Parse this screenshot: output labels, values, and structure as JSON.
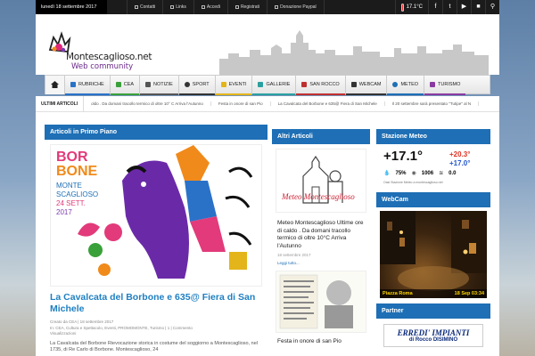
{
  "topbar": {
    "date": "lunedì 18 settembre 2017",
    "links": [
      "Contatti",
      "Links",
      "Accedi",
      "Registrati",
      "Donazione Paypal"
    ],
    "temperature": "17.1°C",
    "social": [
      "facebook-icon",
      "twitter-icon",
      "youtube-icon",
      "video-icon",
      "search-icon"
    ]
  },
  "header": {
    "logo_text": "Montescaglioso.net",
    "logo_sub": "Web community"
  },
  "nav": {
    "items": [
      {
        "label": "RUBRICHE",
        "color": "#2a72c8"
      },
      {
        "label": "CEA",
        "color": "#3aa03a"
      },
      {
        "label": "NOTIZIE",
        "color": "#555555"
      },
      {
        "label": "SPORT",
        "color": "#333333"
      },
      {
        "label": "EVENTI",
        "color": "#e3b51a"
      },
      {
        "label": "GALLERIE",
        "color": "#2aa0a0"
      },
      {
        "label": "SAN ROCCO",
        "color": "#c03030"
      },
      {
        "label": "WEBCAM",
        "color": "#333333"
      },
      {
        "label": "METEO",
        "color": "#1e6fb5"
      },
      {
        "label": "TURISMO",
        "color": "#8a3aa0"
      }
    ]
  },
  "ticker": {
    "label": "ULTIMI ARTICOLI",
    "items": [
      "oldo . Da domani tracollo termico di oltre 10° C Arriva l'Autunno",
      "Festa in onore di san Pio",
      "La Cavalcata del Borbone e 635@ Fiera di San Michele",
      "Il 20 settembre sarà presentato \"Tutipe\" al N"
    ]
  },
  "primo_piano": {
    "title": "Articoli in Primo Piano",
    "poster_lines": [
      "BOR",
      "BONE",
      "MONTE",
      "SCAGLIOSO",
      "24 SETT.",
      "2017"
    ],
    "headline": "La Cavalcata del Borbone e 635@ Fiera di San Michele",
    "meta1": "Creato da CEA  |  18 settembre 2017",
    "meta2": "In: CEA, Cultura e Spettacolo, Eventi, PROMOMONTE, Turismo  |  1  |  Commento",
    "meta3": "Visualizzazioni",
    "excerpt": "La Cavalcata del Borbone Rievocazione storica in costume del soggiorno a Montescaglioso, nel 1735, di Re Carlo di Borbone. Montescaglioso, 24"
  },
  "altri": {
    "title": "Altri Articoli",
    "thumb_label": "Meteo Montescaglioso",
    "article_title": "Meteo Montescaglioso Ultime ore di caldo . Da domani tracollo termico di oltre 10°C Arriva l'Autunno",
    "article_date": "18 settembre 2017",
    "read_more": "Leggi tutto...",
    "article2_title": "Festa in onore di san Pio"
  },
  "meteo": {
    "title": "Stazione Meteo",
    "temp": "+17.1°",
    "hi": "+20.3°",
    "lo": "+17.0°",
    "humidity": "75%",
    "pressure": "1006",
    "wind": "0.0",
    "footer": "Oasi Stazione Meteo a montescaglioso.net"
  },
  "webcam": {
    "title": "WebCam",
    "place": "Piazza Roma",
    "time": "18 Sep 03:34"
  },
  "partner": {
    "title": "Partner",
    "name": "ERREDI' IMPIANTI",
    "sub": "di Rocco DISIMINO"
  }
}
